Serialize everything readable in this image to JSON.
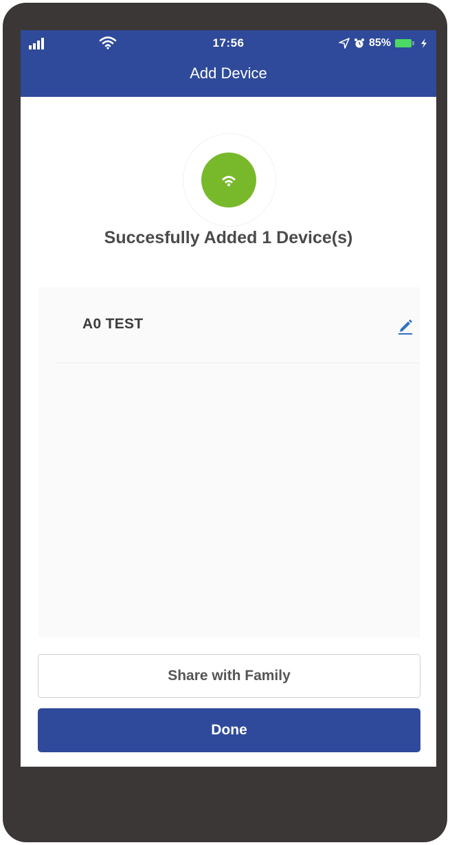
{
  "status_bar": {
    "time": "17:56",
    "battery": "85%"
  },
  "header": {
    "title": "Add Device"
  },
  "success": {
    "message": "Succesfully Added 1 Device(s)"
  },
  "devices": [
    {
      "name": "A0 TEST"
    }
  ],
  "buttons": {
    "share_label": "Share with Family",
    "done_label": "Done"
  },
  "colors": {
    "header_blue": "#2f4a9a",
    "success_green": "#78b92c",
    "frame_dark": "#3b3736"
  }
}
